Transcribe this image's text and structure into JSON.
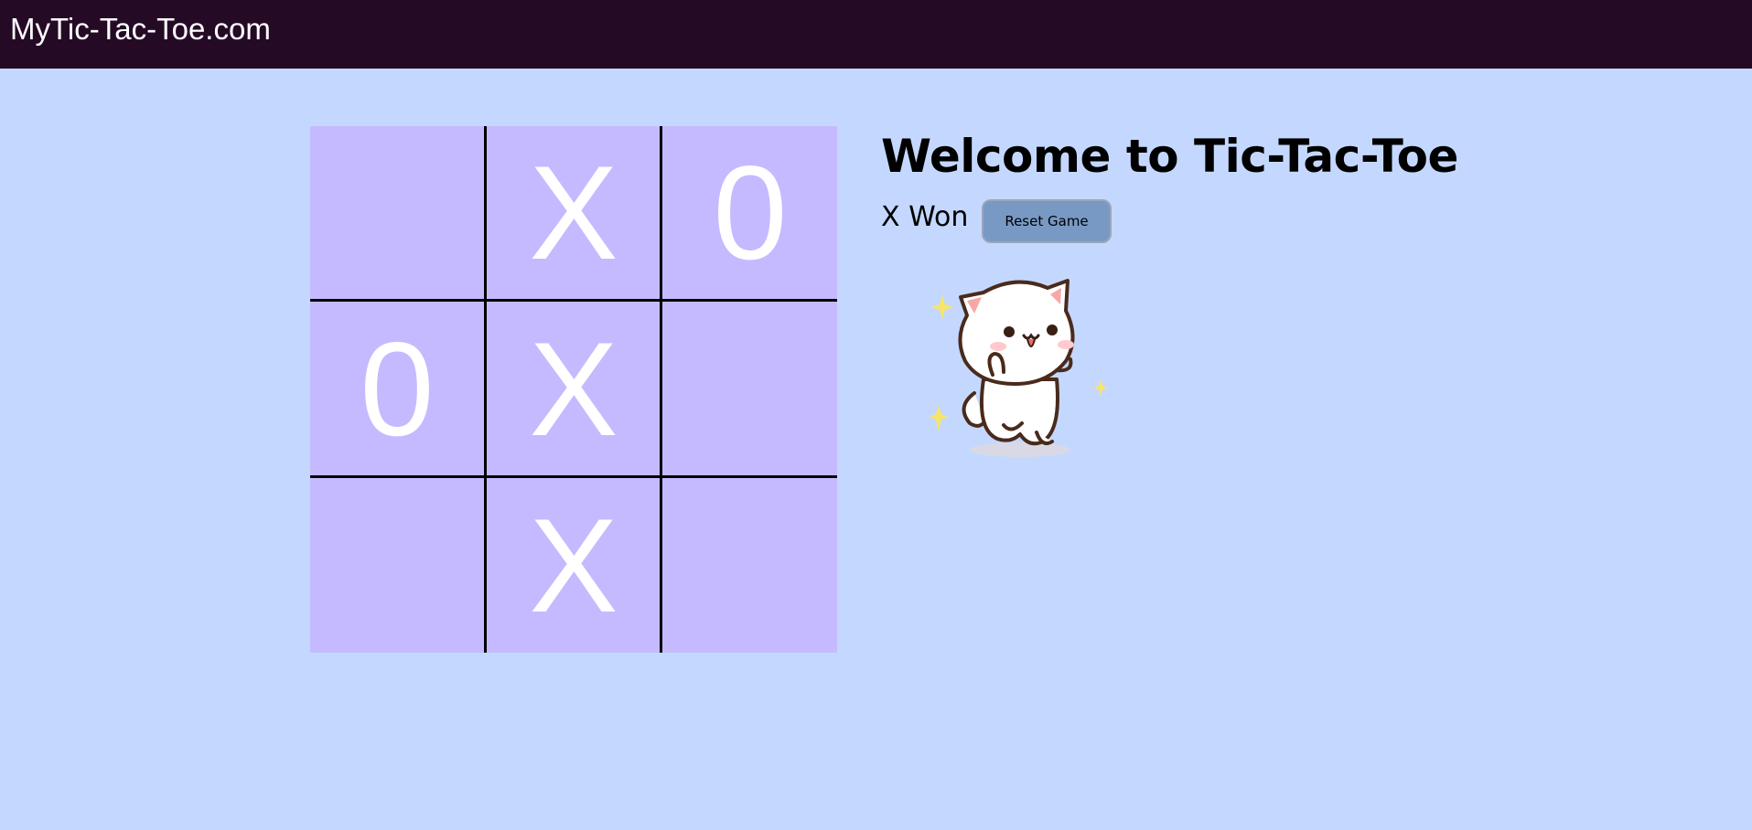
{
  "navbar": {
    "brand": "MyTic-Tac-Toe.com"
  },
  "board": {
    "cells": [
      "",
      "X",
      "0",
      "0",
      "X",
      "",
      "",
      "X",
      ""
    ]
  },
  "game": {
    "title": "Welcome to Tic-Tac-Toe",
    "status": "X Won",
    "reset_label": "Reset Game"
  },
  "colors": {
    "navbar": "#250a26",
    "background": "#c4d8ff",
    "cell": "#c5baff",
    "mark": "#ffffff",
    "reset_button": "#7899c4"
  },
  "icons": {
    "celebration": "dancing-cat-sticker"
  }
}
